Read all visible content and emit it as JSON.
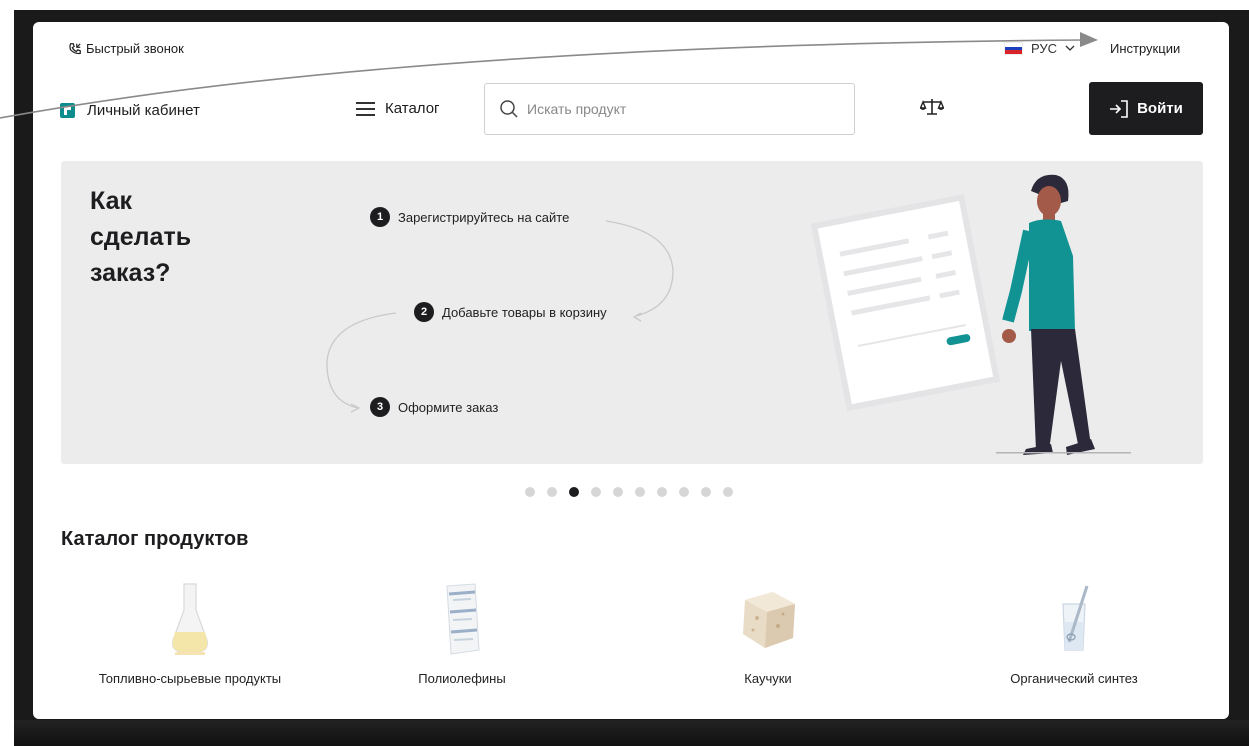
{
  "topbar": {
    "quick_call": "Быстрый звонок",
    "language": "РУС",
    "instructions": "Инструкции"
  },
  "header": {
    "account": "Личный кабинет",
    "catalog": "Каталог",
    "search_placeholder": "Искать продукт",
    "login": "Войти"
  },
  "banner": {
    "title": "Как\nсделать\nзаказ?",
    "steps": [
      {
        "num": "1",
        "text": "Зарегистрируйтесь на сайте"
      },
      {
        "num": "2",
        "text": "Добавьте товары в корзину"
      },
      {
        "num": "3",
        "text": "Оформите заказ"
      }
    ]
  },
  "carousel": {
    "active_index": 2,
    "count": 10
  },
  "catalog": {
    "title": "Каталог продуктов",
    "items": [
      {
        "label": "Топливно-сырьевые продукты",
        "icon": "flask-icon"
      },
      {
        "label": "Полиолефины",
        "icon": "bag-icon"
      },
      {
        "label": "Каучуки",
        "icon": "rubber-block-icon"
      },
      {
        "label": "Органический синтез",
        "icon": "beaker-icon"
      }
    ]
  },
  "colors": {
    "accent": "#0c8c8c",
    "dark": "#1d1d1f",
    "banner_bg": "#ececed",
    "figure_shirt": "#119394"
  }
}
